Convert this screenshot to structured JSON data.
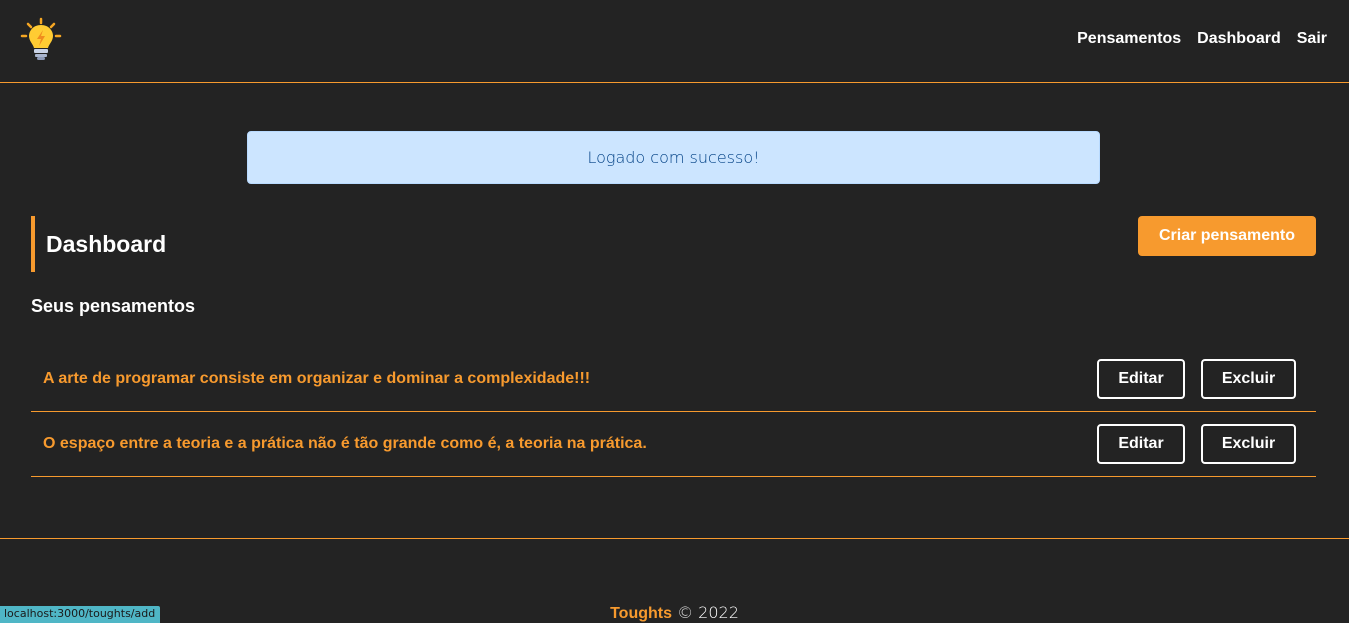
{
  "navbar": {
    "logo_icon": "lightbulb-icon",
    "links": [
      {
        "label": "Pensamentos"
      },
      {
        "label": "Dashboard"
      },
      {
        "label": "Sair"
      }
    ]
  },
  "flash": {
    "message": "Logado com sucesso!"
  },
  "dashboard": {
    "title": "Dashboard",
    "create_button": "Criar pensamento",
    "subtitle": "Seus pensamentos",
    "thoughts": [
      {
        "text": "A arte de programar consiste em organizar e dominar a complexidade!!!",
        "edit": "Editar",
        "delete": "Excluir"
      },
      {
        "text": "O espaço entre a teoria e a prática não é tão grande como é, a teoria na prática.",
        "edit": "Editar",
        "delete": "Excluir"
      }
    ]
  },
  "footer": {
    "brand": "Toughts",
    "copyright": "© 2022"
  },
  "status_bar": {
    "url": "localhost:3000/toughts/add"
  },
  "colors": {
    "accent": "#f79a2e",
    "background": "#232323",
    "flash_bg": "#cce5ff",
    "flash_text": "#004085"
  }
}
